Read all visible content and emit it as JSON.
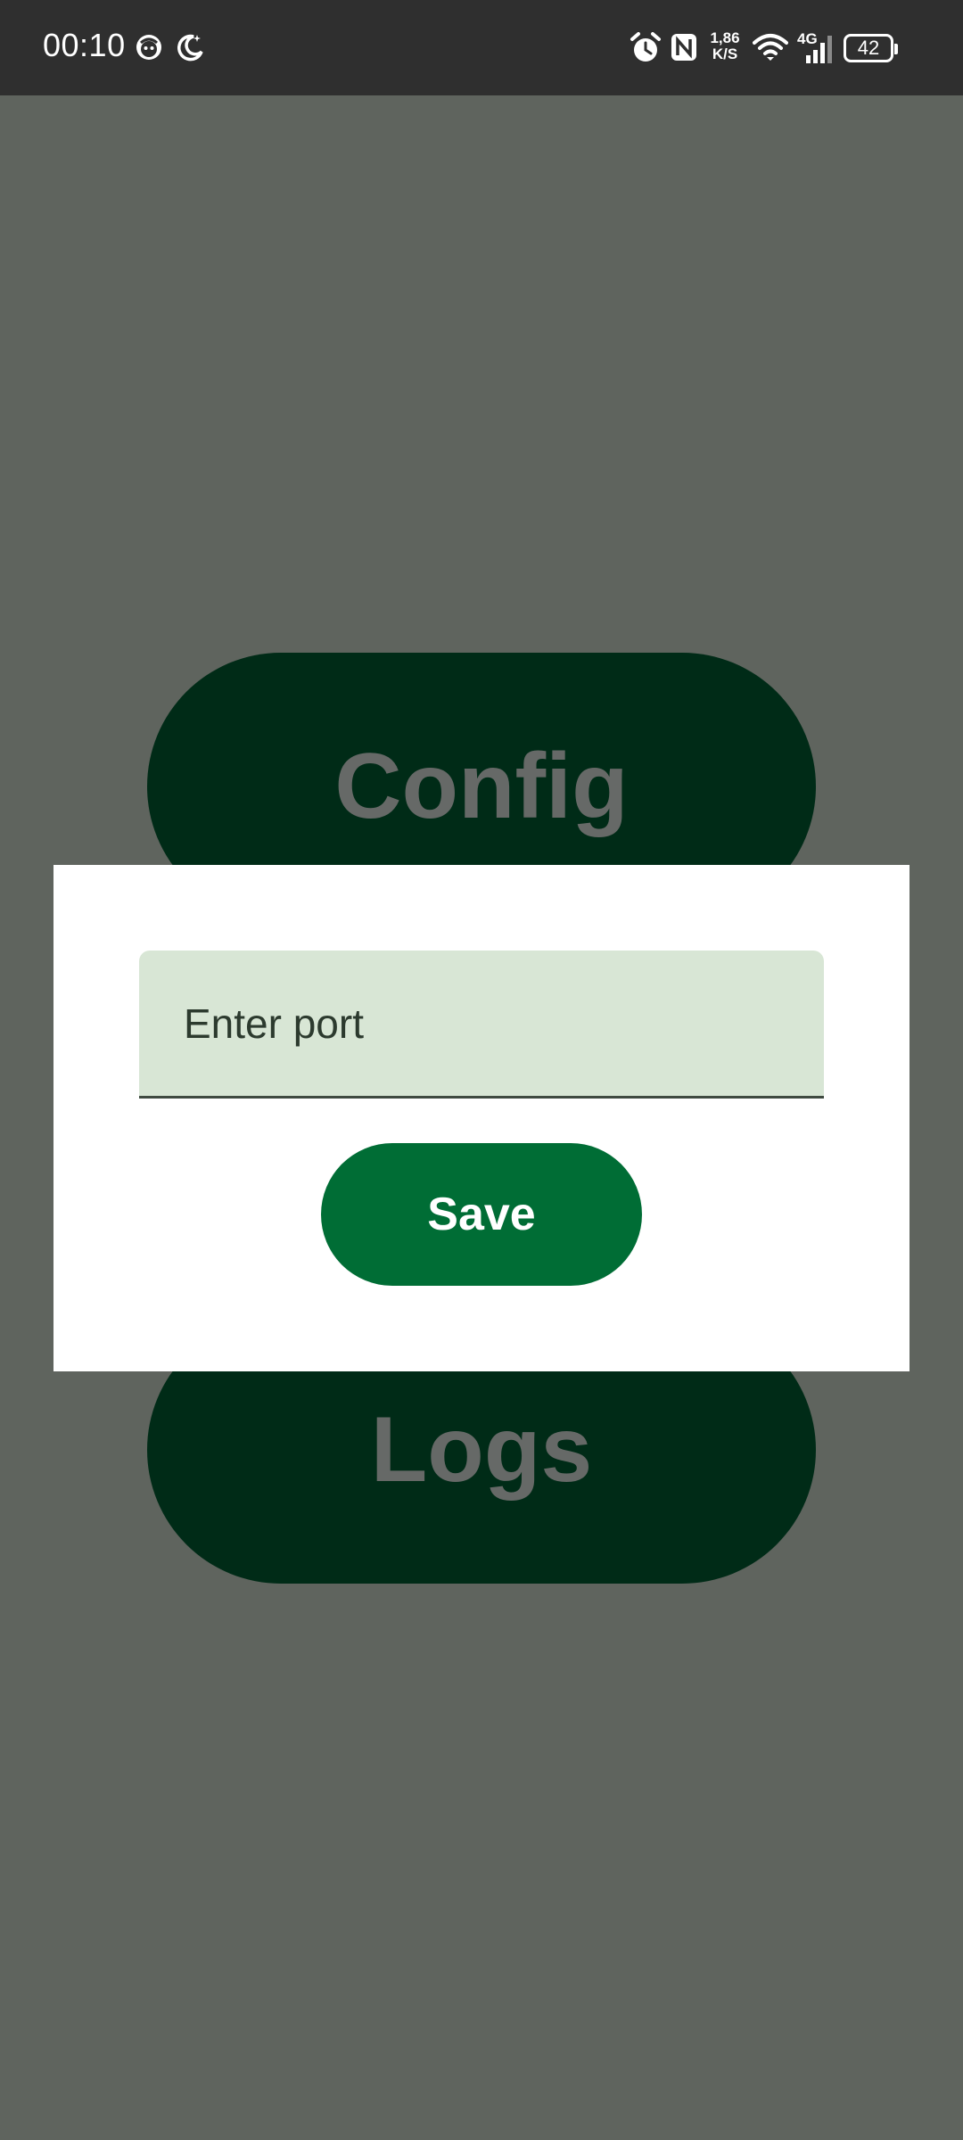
{
  "status_bar": {
    "time": "00:10",
    "left_icons": [
      "face-icon",
      "do-not-disturb-moon-icon"
    ],
    "right_icons": [
      "alarm-icon",
      "nfc-icon",
      "network-speed",
      "wifi-icon",
      "cellular-4g-icon",
      "battery-icon"
    ],
    "speed_value": "1,86",
    "speed_unit": "K/S",
    "network_type": "4G",
    "battery_level": "42"
  },
  "background": {
    "config_label": "Config",
    "logs_label": "Logs"
  },
  "dialog": {
    "port_placeholder": "Enter port",
    "port_value": "",
    "save_label": "Save"
  },
  "colors": {
    "scrim": "#5f645e",
    "status_bar": "#2f2f2f",
    "main_button": "#002b17",
    "field_bg": "#d8e6d5",
    "save_button": "#006d35"
  }
}
